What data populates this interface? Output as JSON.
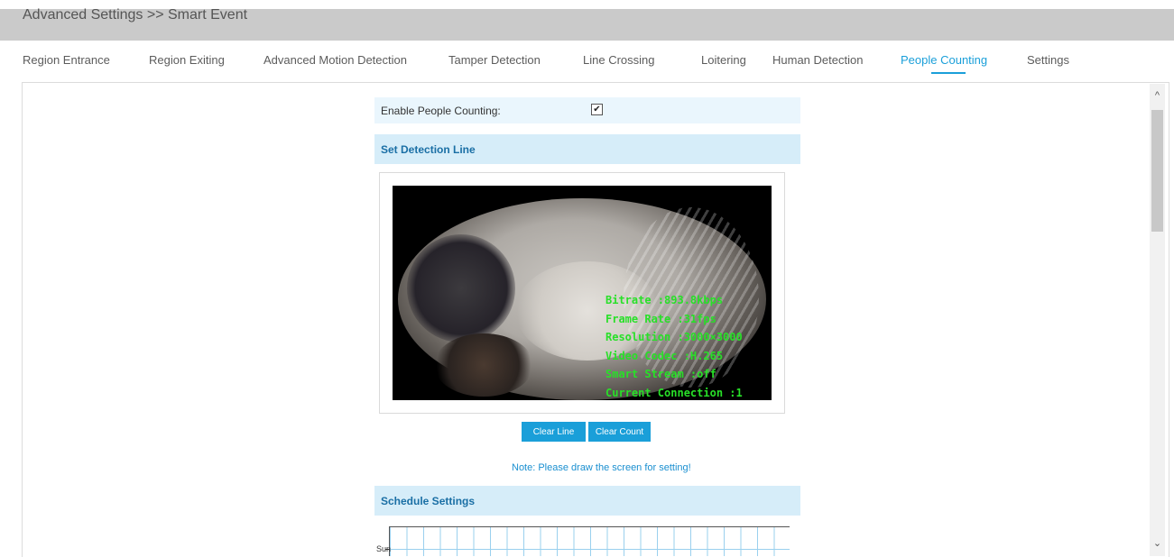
{
  "breadcrumb": "Advanced Settings >> Smart Event",
  "tabs": [
    {
      "label": "Region Entrance",
      "active": false
    },
    {
      "label": "Region Exiting",
      "active": false
    },
    {
      "label": "Advanced Motion Detection",
      "active": false
    },
    {
      "label": "Tamper Detection",
      "active": false
    },
    {
      "label": "Line Crossing",
      "active": false
    },
    {
      "label": "Loitering",
      "active": false
    },
    {
      "label": "Human Detection",
      "active": false
    },
    {
      "label": "People Counting",
      "active": true
    },
    {
      "label": "Settings",
      "active": false
    }
  ],
  "enable": {
    "label": "Enable People Counting:",
    "checked": true,
    "check_glyph": "✔"
  },
  "detection_line": {
    "title": "Set Detection Line"
  },
  "osd": [
    "Bitrate :893.8kbps",
    "Frame Rate :31fps",
    "Resolution :3000×3000",
    "Video Codec :H.265",
    "Smart Stream :off",
    "Current Connection :1"
  ],
  "buttons": {
    "clear_line": "Clear Line",
    "clear_count": "Clear Count"
  },
  "note": "Note: Please draw the screen for setting!",
  "schedule": {
    "title": "Schedule Settings",
    "first_day": "Sun"
  },
  "scroll": {
    "up_glyph": "^",
    "down_glyph": "⌄"
  },
  "colors": {
    "accent": "#1a9fd9",
    "section_header": "#d6edf9",
    "osd_text": "#28e028"
  }
}
